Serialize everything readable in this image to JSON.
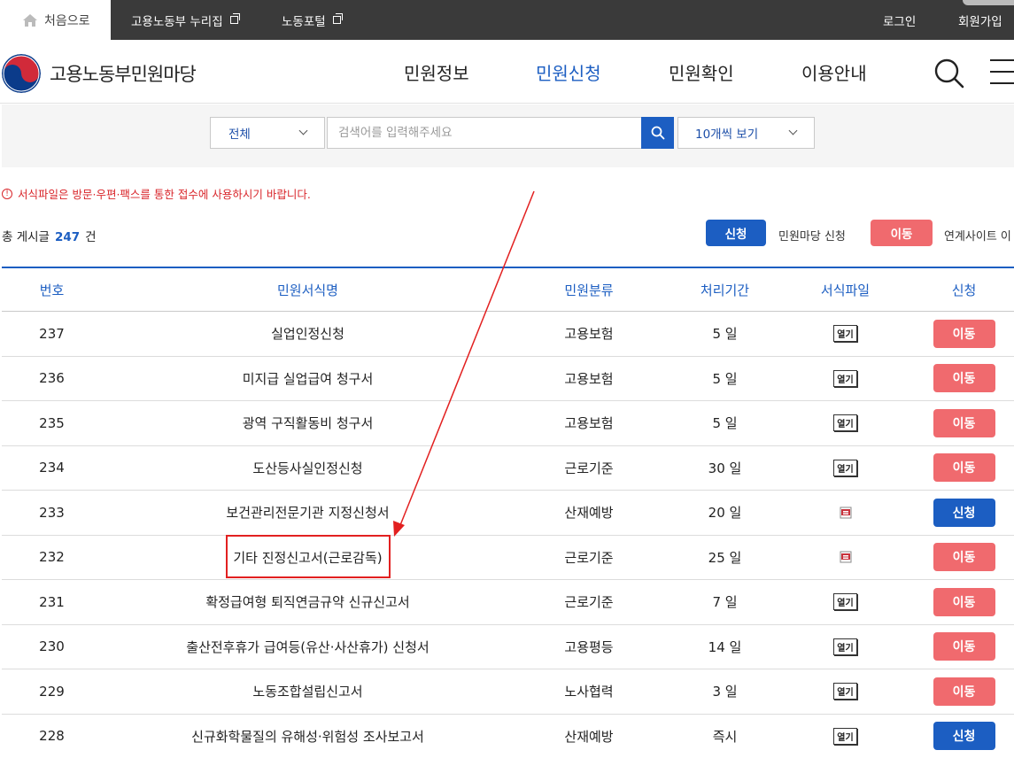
{
  "topbar": {
    "home_label": "처음으로",
    "links": [
      {
        "label": "고용노동부 누리집"
      },
      {
        "label": "노동포털"
      }
    ],
    "login": "로그인",
    "signup": "회원가입"
  },
  "header": {
    "logo_text": "고용노동부민원마당",
    "nav": [
      {
        "label": "민원정보"
      },
      {
        "label": "민원신청",
        "active": true
      },
      {
        "label": "민원확인"
      },
      {
        "label": "이용안내"
      }
    ]
  },
  "search": {
    "category_value": "전체",
    "placeholder": "검색어를 입력해주세요",
    "page_size_value": "10개씩 보기"
  },
  "notice": "서식파일은 방문·우편·팩스를 통한 접수에 사용하시기 바랍니다.",
  "total": {
    "prefix": "총 게시글",
    "count": "247",
    "suffix": "건"
  },
  "legend": {
    "apply_btn": "신청",
    "apply_text": "민원마당 신청",
    "move_btn": "이동",
    "move_text": "연계사이트 이"
  },
  "table": {
    "headers": [
      "번호",
      "민원서식명",
      "민원분류",
      "처리기간",
      "서식파일",
      "신청"
    ],
    "open_label": "열기",
    "rows": [
      {
        "no": "237",
        "name": "실업인정신청",
        "category": "고용보험",
        "period": "5 일",
        "file": "open",
        "action": "이동",
        "action_type": "move"
      },
      {
        "no": "236",
        "name": "미지급 실업급여 청구서",
        "category": "고용보험",
        "period": "5 일",
        "file": "open",
        "action": "이동",
        "action_type": "move"
      },
      {
        "no": "235",
        "name": "광역 구직활동비 청구서",
        "category": "고용보험",
        "period": "5 일",
        "file": "open",
        "action": "이동",
        "action_type": "move"
      },
      {
        "no": "234",
        "name": "도산등사실인정신청",
        "category": "근로기준",
        "period": "30 일",
        "file": "open",
        "action": "이동",
        "action_type": "move"
      },
      {
        "no": "233",
        "name": "보건관리전문기관 지정신청서",
        "category": "산재예방",
        "period": "20 일",
        "file": "hwp",
        "action": "신청",
        "action_type": "apply"
      },
      {
        "no": "232",
        "name": "기타 진정신고서(근로감독)",
        "category": "근로기준",
        "period": "25 일",
        "file": "hwp",
        "action": "이동",
        "action_type": "move"
      },
      {
        "no": "231",
        "name": "확정급여형 퇴직연금규약 신규신고서",
        "category": "근로기준",
        "period": "7 일",
        "file": "open",
        "action": "이동",
        "action_type": "move"
      },
      {
        "no": "230",
        "name": "출산전후휴가 급여등(유산·사산휴가) 신청서",
        "category": "고용평등",
        "period": "14 일",
        "file": "open",
        "action": "이동",
        "action_type": "move"
      },
      {
        "no": "229",
        "name": "노동조합설립신고서",
        "category": "노사협력",
        "period": "3 일",
        "file": "open",
        "action": "이동",
        "action_type": "move"
      },
      {
        "no": "228",
        "name": "신규화학물질의 유해성·위험성 조사보고서",
        "category": "산재예방",
        "period": "즉시",
        "file": "open",
        "action": "신청",
        "action_type": "apply"
      }
    ]
  },
  "colors": {
    "primary": "#1c5ec2",
    "move": "#f06a6e",
    "notice": "#d9262b",
    "annotation": "#e22020"
  },
  "icons": {
    "home": "home-icon",
    "external": "external-link-icon",
    "search": "search-icon",
    "menu": "hamburger-menu-icon",
    "hwp": "hwp-file-icon",
    "notice": "info-circle-icon"
  }
}
